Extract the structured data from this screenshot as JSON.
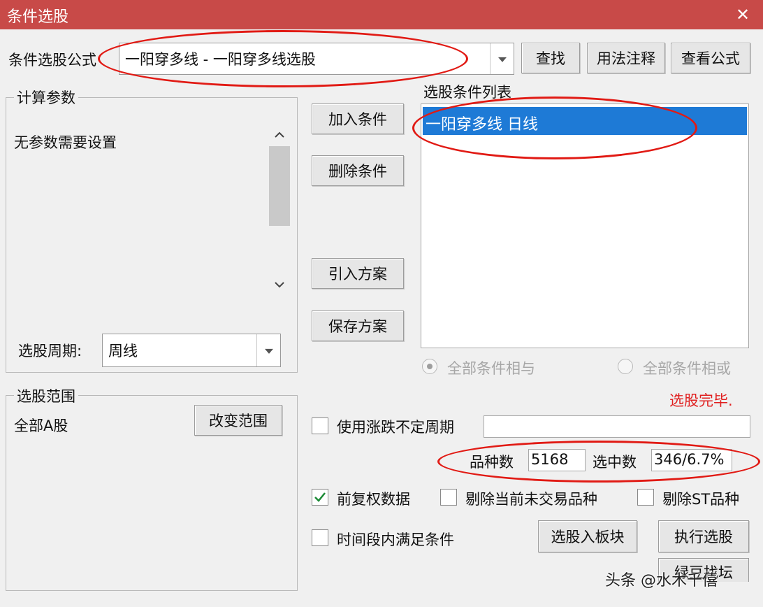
{
  "window": {
    "title": "条件选股",
    "close": "✕"
  },
  "formula": {
    "label": "条件选股公式",
    "value": "一阳穿多线  -  一阳穿多线选股"
  },
  "buttons": {
    "find": "查找",
    "usage": "用法注释",
    "view_formula": "查看公式",
    "add_condition": "加入条件",
    "delete_condition": "删除条件",
    "import_plan": "引入方案",
    "save_plan": "保存方案",
    "change_range": "改变范围",
    "to_block": "选股入板块",
    "execute": "执行选股",
    "partial": "绿豆找坛"
  },
  "params": {
    "title": "计算参数",
    "text": "无参数需要设置"
  },
  "period": {
    "label": "选股周期:",
    "value": "周线"
  },
  "conditions": {
    "title": "选股条件列表",
    "items": [
      "一阳穿多线  日线"
    ],
    "selected_index": 0
  },
  "logic": {
    "and_label": "全部条件相与",
    "or_label": "全部条件相或",
    "selected": "and"
  },
  "status": {
    "text": "选股完毕."
  },
  "options": {
    "variable_period": {
      "label": "使用涨跌不定周期",
      "checked": false
    },
    "adjusted": {
      "label": "前复权数据",
      "checked": true
    },
    "remove_untraded": {
      "label": "剔除当前未交易品种",
      "checked": false
    },
    "remove_st": {
      "label": "剔除ST品种",
      "checked": false
    },
    "time_range": {
      "label": "时间段内满足条件",
      "checked": false
    }
  },
  "counts": {
    "total_label": "品种数",
    "total": "5168",
    "selected_label": "选中数",
    "selected": "346/6.7%"
  },
  "range": {
    "title": "选股范围",
    "value": "全部A股"
  },
  "watermark": {
    "text": "头条 @水木千僖"
  },
  "colors": {
    "title_bar": "#c84a48",
    "selection": "#1e7ad6",
    "annotation": "#e11a14",
    "status": "#e02020",
    "check": "#1b8a35"
  }
}
